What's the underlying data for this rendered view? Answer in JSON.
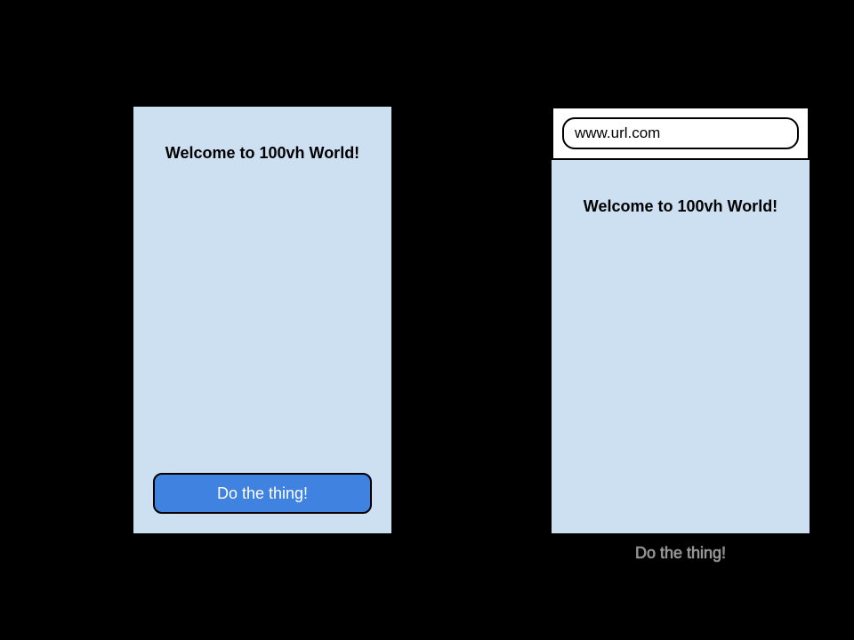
{
  "left": {
    "heading": "Welcome to 100vh World!",
    "button_label": "Do the thing!"
  },
  "right": {
    "url": "www.url.com",
    "heading": "Welcome to 100vh World!",
    "button_label": "Do the thing!"
  }
}
